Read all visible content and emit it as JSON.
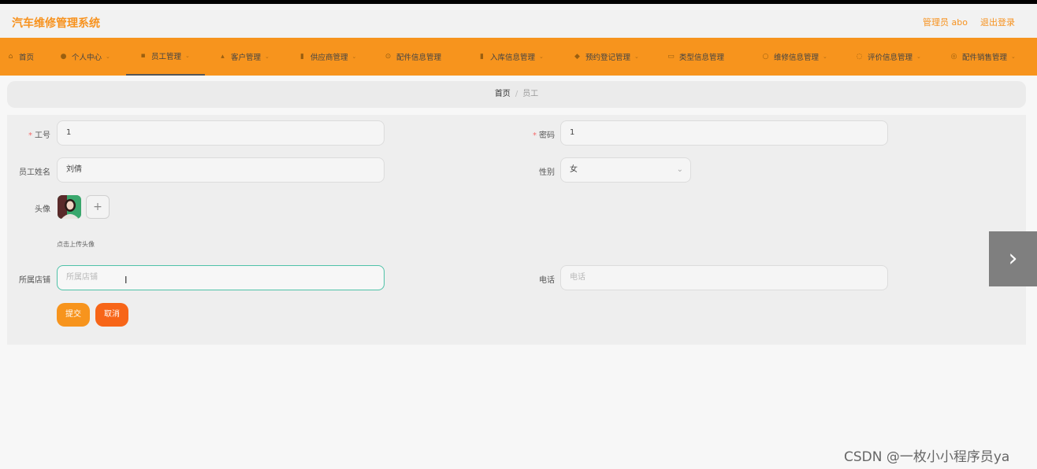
{
  "header": {
    "brand": "汽车维修管理系统",
    "user_label": "管理员 abo",
    "logout_label": "退出登录"
  },
  "nav": {
    "items": [
      {
        "label": "首页",
        "icon": "home-icon"
      },
      {
        "label": "个人中心",
        "icon": "user-icon"
      },
      {
        "label": "员工管理",
        "icon": "employee-icon"
      },
      {
        "label": "客户管理",
        "icon": "customer-icon"
      },
      {
        "label": "供应商管理",
        "icon": "supplier-icon"
      },
      {
        "label": "配件信息管理",
        "icon": "parts-icon"
      },
      {
        "label": "入库信息管理",
        "icon": "stock-in-icon"
      },
      {
        "label": "预约登记管理",
        "icon": "location-icon"
      },
      {
        "label": "类型信息管理",
        "icon": "type-icon"
      },
      {
        "label": "维修信息管理",
        "icon": "repair-icon"
      },
      {
        "label": "评价信息管理",
        "icon": "review-icon"
      },
      {
        "label": "配件销售管理",
        "icon": "sales-icon"
      }
    ],
    "active": "员工管理"
  },
  "breadcrumb": {
    "home": "首页",
    "separator": "/",
    "current": "员工"
  },
  "form": {
    "gonghao_label": "工号",
    "gonghao_value": "1",
    "mima_label": "密码",
    "mima_value": "1",
    "name_label": "员工姓名",
    "name_value": "刘倩",
    "gender_label": "性别",
    "gender_value": "女",
    "avatar_label": "头像",
    "avatar_hint": "点击上传头像",
    "store_label": "所属店铺",
    "store_placeholder": "所属店铺",
    "phone_label": "电话",
    "phone_placeholder": "电话",
    "required_mark": "*"
  },
  "buttons": {
    "submit": "提交",
    "cancel": "取消"
  },
  "watermark": "CSDN @一枚小小程序员ya",
  "colors": {
    "accent": "#f7941d",
    "cancel": "#f76518",
    "focus": "#4fc2a8"
  }
}
